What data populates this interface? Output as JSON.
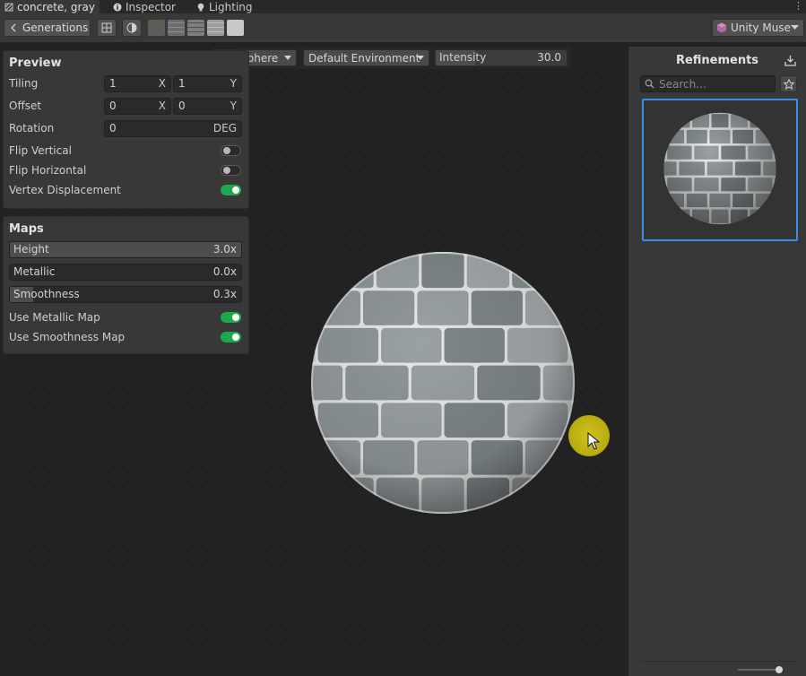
{
  "tabs": [
    {
      "label": "concrete, gray",
      "icon": "material-icon",
      "active": true
    },
    {
      "label": "Inspector",
      "icon": "info-icon",
      "active": false
    },
    {
      "label": "Lighting",
      "icon": "lightbulb-icon",
      "active": false
    }
  ],
  "toolbar": {
    "generations_label": "Generations",
    "account_label": "Unity Muse"
  },
  "viewport": {
    "shape_label": "Sphere",
    "environment_label": "Default Environment",
    "intensity_label": "Intensity",
    "intensity_value": "30.0",
    "intensity_fraction": 0.3
  },
  "preview": {
    "title": "Preview",
    "tiling": {
      "label": "Tiling",
      "x": "1",
      "x_unit": "X",
      "y": "1",
      "y_unit": "Y"
    },
    "offset": {
      "label": "Offset",
      "x": "0",
      "x_unit": "X",
      "y": "0",
      "y_unit": "Y"
    },
    "rotation": {
      "label": "Rotation",
      "value": "0",
      "unit": "DEG"
    },
    "flip_vertical": {
      "label": "Flip Vertical",
      "on": false
    },
    "flip_horizontal": {
      "label": "Flip Horizontal",
      "on": false
    },
    "vertex_displacement": {
      "label": "Vertex Displacement",
      "on": true
    }
  },
  "maps": {
    "title": "Maps",
    "height": {
      "label": "Height",
      "value": "3.0x",
      "fraction": 1.0
    },
    "metallic": {
      "label": "Metallic",
      "value": "0.0x",
      "fraction": 0.0
    },
    "smoothness": {
      "label": "Smoothness",
      "value": "0.3x",
      "fraction": 0.1
    },
    "use_metallic_map": {
      "label": "Use Metallic Map",
      "on": true
    },
    "use_smoothness_map": {
      "label": "Use Smoothness Map",
      "on": true
    }
  },
  "refinements": {
    "title": "Refinements",
    "search_placeholder": "Search..."
  },
  "colors": {
    "accent_blue": "#3a8ee6",
    "toggle_on": "#1ea84c",
    "cursor_highlight": "#c8bb14"
  }
}
